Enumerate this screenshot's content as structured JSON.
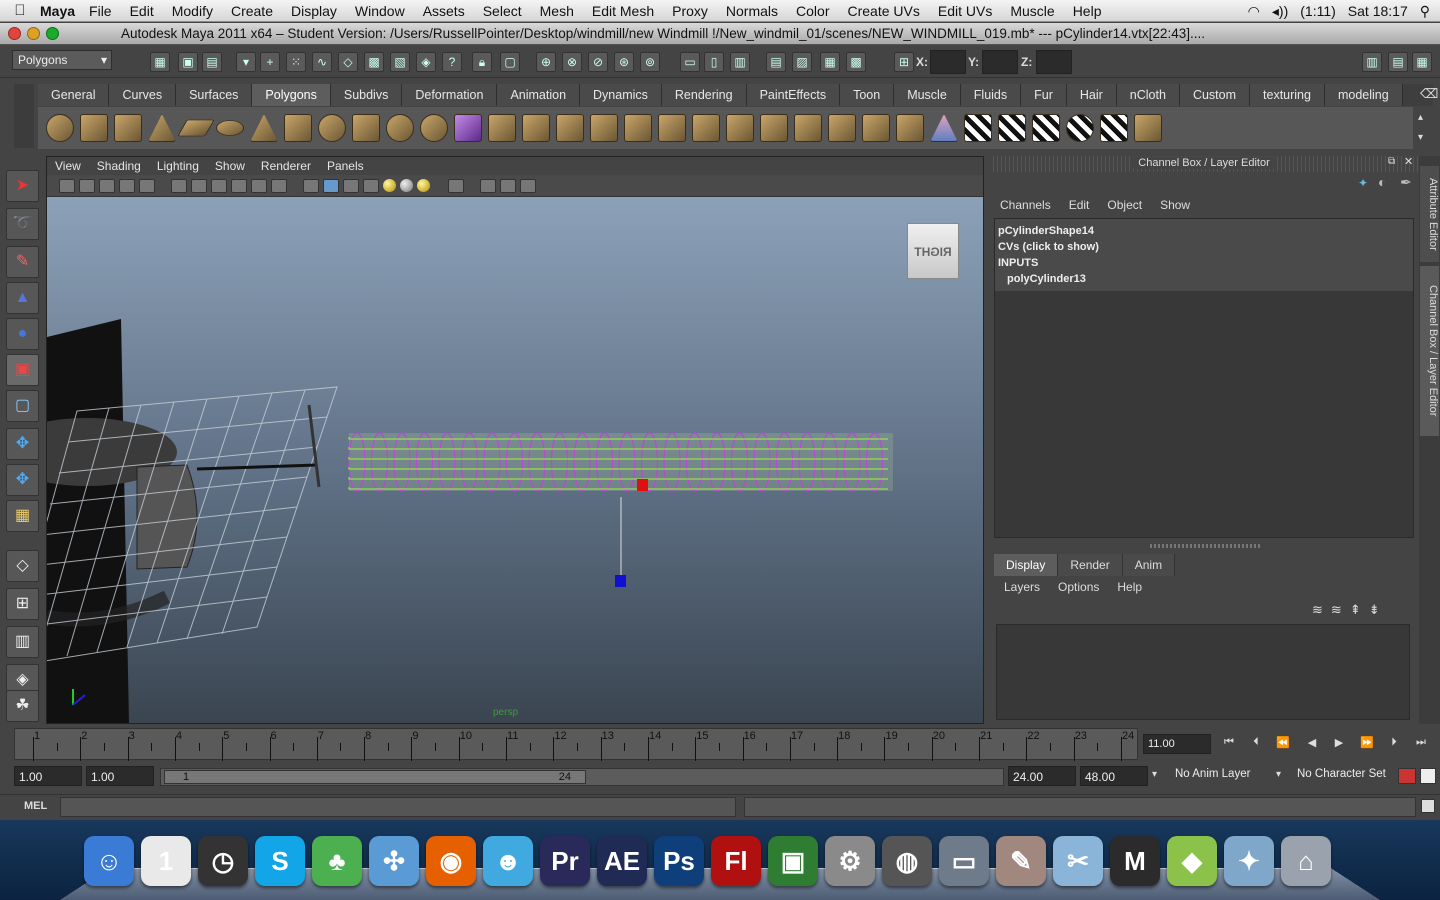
{
  "mac_menubar": {
    "app_name": "Maya",
    "items": [
      "File",
      "Edit",
      "Modify",
      "Create",
      "Display",
      "Window",
      "Assets",
      "Select",
      "Mesh",
      "Edit Mesh",
      "Proxy",
      "Normals",
      "Color",
      "Create UVs",
      "Edit UVs",
      "Muscle",
      "Help"
    ],
    "battery": "(1:11)",
    "clock": "Sat 18:17"
  },
  "window": {
    "title": "Autodesk Maya 2011 x64 – Student Version: /Users/RussellPointer/Desktop/windmill/new Windmill !/New_windmil_01/scenes/NEW_WINDMILL_019.mb*   ---    pCylinder14.vtx[22:43]...."
  },
  "statusline": {
    "menu_set": "Polygons",
    "x_label": "X:",
    "y_label": "Y:",
    "z_label": "Z:"
  },
  "shelf": {
    "tabs": [
      "General",
      "Curves",
      "Surfaces",
      "Polygons",
      "Subdivs",
      "Deformation",
      "Animation",
      "Dynamics",
      "Rendering",
      "PaintEffects",
      "Toon",
      "Muscle",
      "Fluids",
      "Fur",
      "Hair",
      "nCloth",
      "Custom",
      "texturing",
      "modeling"
    ],
    "active_tab": "Polygons"
  },
  "viewport": {
    "menu": [
      "View",
      "Shading",
      "Lighting",
      "Show",
      "Renderer",
      "Panels"
    ],
    "viewcube_label": "RIGHT",
    "camera_label": "persp"
  },
  "channel_box": {
    "title": "Channel Box / Layer Editor",
    "menu": [
      "Channels",
      "Edit",
      "Object",
      "Show"
    ],
    "shape_name": "pCylinderShape14",
    "cvs_text": "CVs (click to show)",
    "inputs_label": "INPUTS",
    "input_node": "polyCylinder13"
  },
  "layer_editor": {
    "tabs": [
      "Display",
      "Render",
      "Anim"
    ],
    "active_tab": "Display",
    "menu": [
      "Layers",
      "Options",
      "Help"
    ]
  },
  "side_tabs": {
    "attribute_editor": "Attribute Editor",
    "channel_box": "Channel Box / Layer Editor"
  },
  "time_slider": {
    "ticks": [
      "1",
      "2",
      "3",
      "4",
      "5",
      "6",
      "7",
      "8",
      "9",
      "10",
      "11",
      "12",
      "13",
      "14",
      "15",
      "16",
      "17",
      "18",
      "19",
      "20",
      "21",
      "22",
      "23",
      "24"
    ],
    "current_frame": "11.00"
  },
  "range_slider": {
    "anim_start": "1.00",
    "range_start": "1.00",
    "handle_start": "1",
    "handle_end": "24",
    "range_end": "24.00",
    "anim_end": "48.00",
    "anim_layer": "No Anim Layer",
    "character_set": "No Character Set"
  },
  "command_line": {
    "label": "MEL"
  },
  "dock": {
    "items": [
      {
        "name": "finder-icon",
        "glyph": "☺",
        "color": "#3a7bd5"
      },
      {
        "name": "ical-icon",
        "glyph": "1",
        "color": "#e9e9e9"
      },
      {
        "name": "dashboard-icon",
        "glyph": "◷",
        "color": "#333333"
      },
      {
        "name": "skype-icon",
        "glyph": "S",
        "color": "#12a5e8"
      },
      {
        "name": "adium-icon",
        "glyph": "♣",
        "color": "#4caf50"
      },
      {
        "name": "safari-icon",
        "glyph": "✣",
        "color": "#5b9bd5"
      },
      {
        "name": "firefox-icon",
        "glyph": "◉",
        "color": "#e66000"
      },
      {
        "name": "messenger-icon",
        "glyph": "☻",
        "color": "#3fa9e0"
      },
      {
        "name": "premiere-icon",
        "glyph": "Pr",
        "color": "#2a2a5a"
      },
      {
        "name": "after-effects-icon",
        "glyph": "AE",
        "color": "#1f2a55"
      },
      {
        "name": "photoshop-icon",
        "glyph": "Ps",
        "color": "#0f3f7a"
      },
      {
        "name": "flash-icon",
        "glyph": "Fl",
        "color": "#b01010"
      },
      {
        "name": "ichat-icon",
        "glyph": "▣",
        "color": "#2e7d32"
      },
      {
        "name": "system-prefs-icon",
        "glyph": "⚙",
        "color": "#8a8a8a"
      },
      {
        "name": "image-capture-icon",
        "glyph": "◍",
        "color": "#555555"
      },
      {
        "name": "remote-desktop-icon",
        "glyph": "▭",
        "color": "#6d7b8a"
      },
      {
        "name": "art-tools-icon",
        "glyph": "✎",
        "color": "#a1887f"
      },
      {
        "name": "preview-icon",
        "glyph": "✂",
        "color": "#8ab4d8"
      },
      {
        "name": "maya-icon",
        "glyph": "M",
        "color": "#2b2b2b"
      },
      {
        "name": "3d-box-icon",
        "glyph": "◆",
        "color": "#8bc34a"
      },
      {
        "name": "iphoto-icon",
        "glyph": "✦",
        "color": "#7fa7c9"
      },
      {
        "name": "trash-icon",
        "glyph": "⌂",
        "color": "#9aa3ad"
      }
    ]
  }
}
